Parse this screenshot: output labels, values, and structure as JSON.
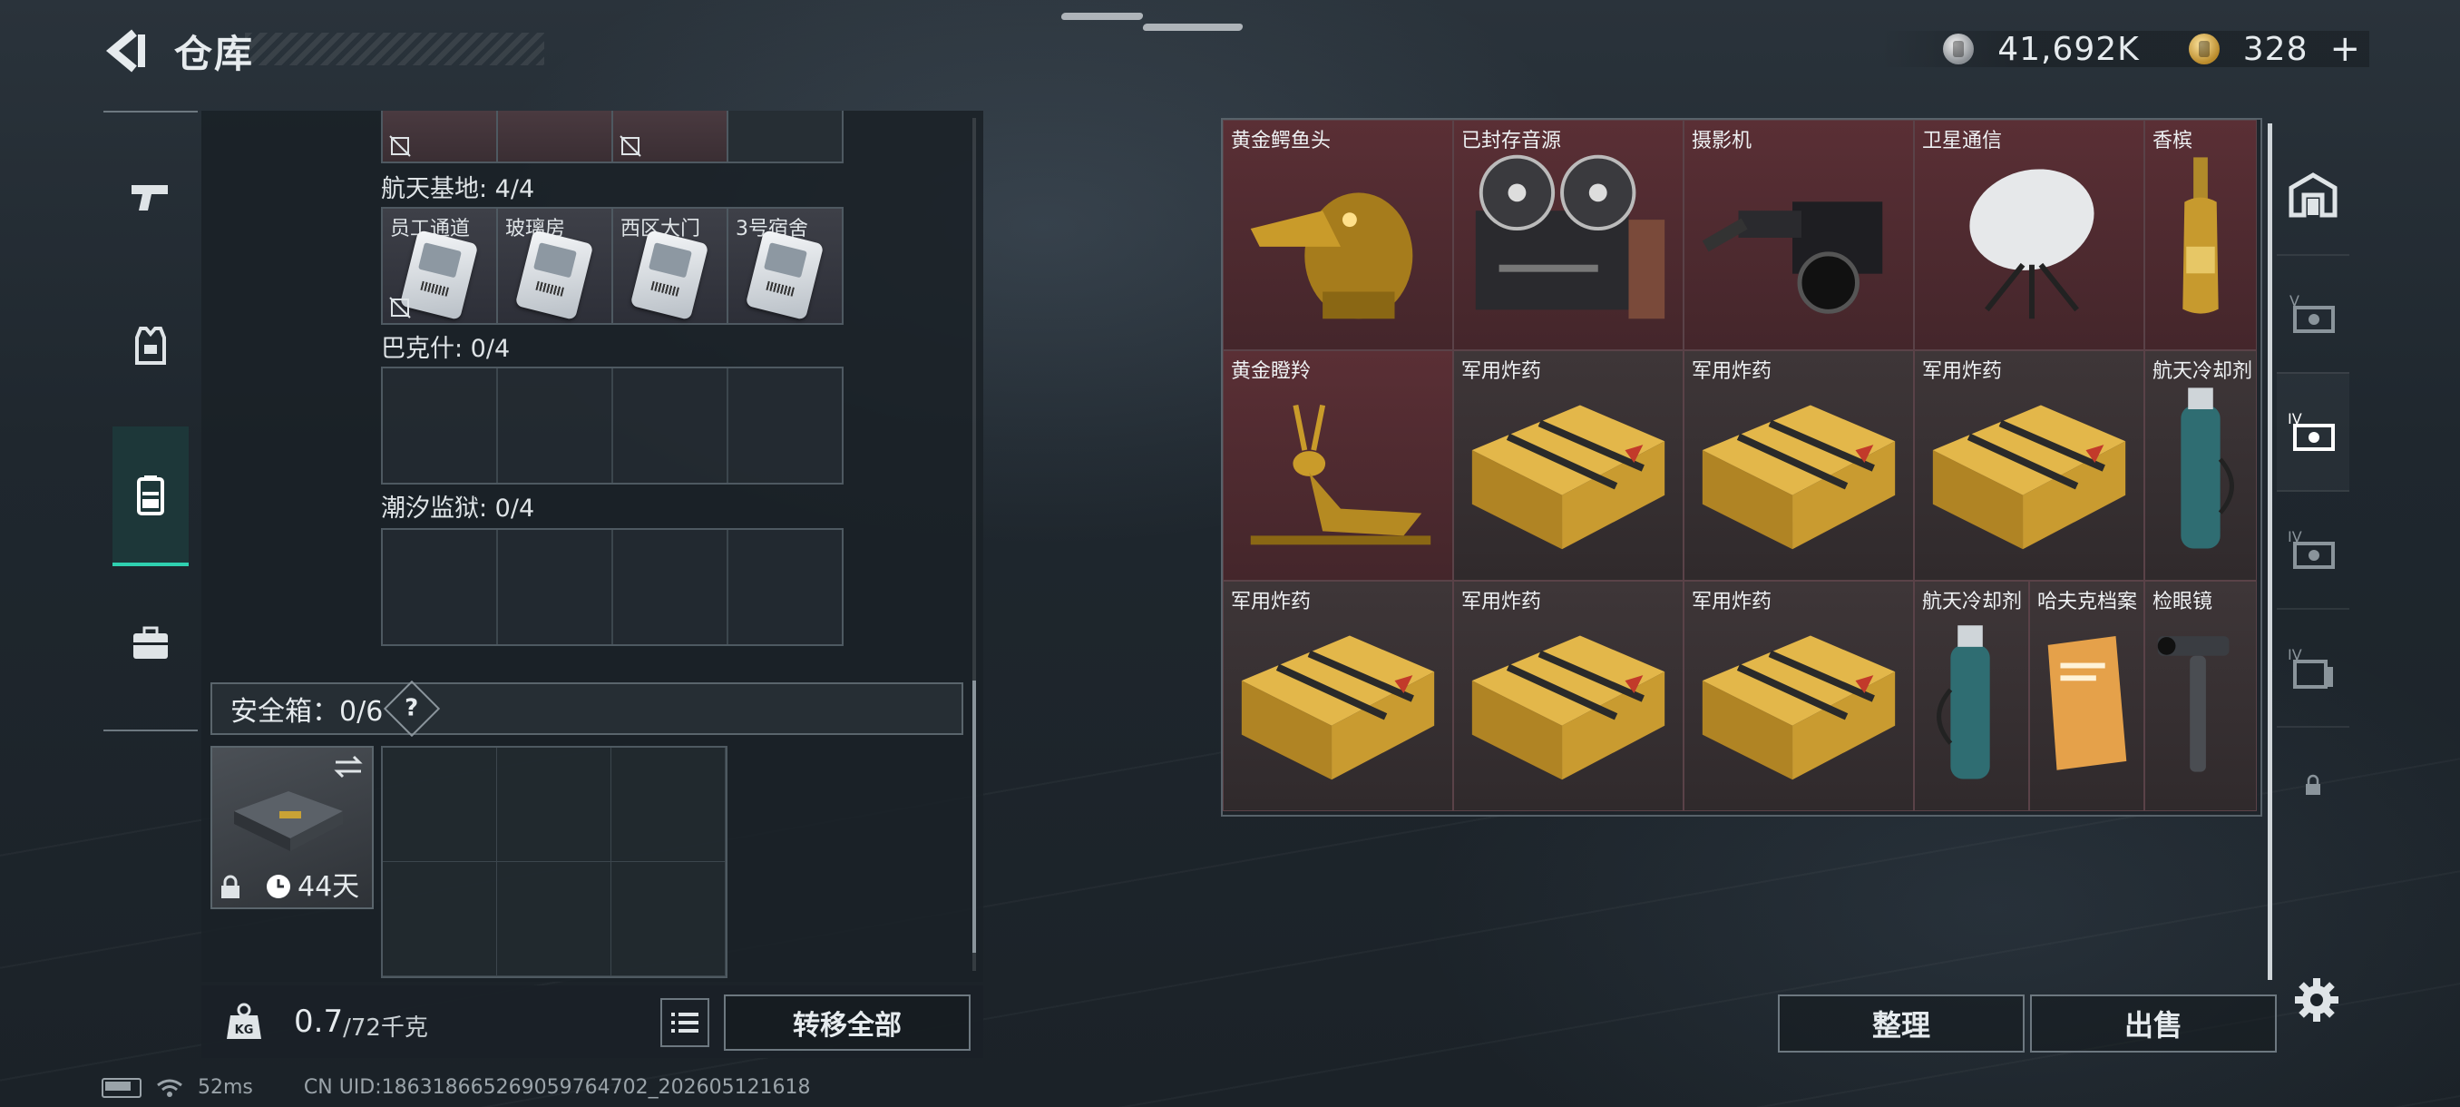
{
  "header": {
    "title": "仓库",
    "silver_amount": "41,692K",
    "gold_amount": "328",
    "gold_add": "+"
  },
  "left_nav": [
    {
      "icon": "pistol-icon"
    },
    {
      "icon": "armor-vest-icon"
    },
    {
      "icon": "backpack-icon",
      "active": true
    },
    {
      "icon": "briefcase-icon"
    }
  ],
  "key_groups": [
    {
      "label": "航天基地: 4/4",
      "keys": [
        "员工通道",
        "玻璃房",
        "西区大门",
        "3号宿舍"
      ]
    },
    {
      "label": "巴克什: 0/4"
    },
    {
      "label": "潮汐监狱: 0/4"
    }
  ],
  "safe_box": {
    "label": "安全箱：0/6",
    "help": "?",
    "days": "44天"
  },
  "weight": {
    "current": "0.7",
    "max": "/72千克"
  },
  "buttons": {
    "transfer_all": "转移全部",
    "sort": "整理",
    "sell": "出售"
  },
  "status": {
    "ping": "52ms",
    "uid": "CN UID:186318665269059764702_202605121618"
  },
  "stash_items": [
    {
      "name": "黄金鳄鱼头",
      "style": "red",
      "icon": "gold-crocodile-head-icon"
    },
    {
      "name": "已封存音源",
      "style": "red",
      "icon": "reel-to-reel-recorder-icon"
    },
    {
      "name": "摄影机",
      "style": "red",
      "icon": "film-camera-icon"
    },
    {
      "name": "卫星通信",
      "style": "red",
      "icon": "satellite-dish-icon"
    },
    {
      "name": "香槟",
      "style": "red",
      "icon": "champagne-bottle-icon"
    },
    {
      "name": "黄金瞪羚",
      "style": "red",
      "icon": "gold-gazelle-icon"
    },
    {
      "name": "军用炸药",
      "style": "dark",
      "icon": "explosive-crate-icon"
    },
    {
      "name": "军用炸药",
      "style": "dark",
      "icon": "explosive-crate-icon"
    },
    {
      "name": "军用炸药",
      "style": "dark",
      "icon": "explosive-crate-icon"
    },
    {
      "name": "航天冷却剂",
      "style": "dark",
      "icon": "coolant-tank-icon"
    },
    {
      "name": "军用炸药",
      "style": "dark",
      "icon": "explosive-crate-icon"
    },
    {
      "name": "军用炸药",
      "style": "dark",
      "icon": "explosive-crate-icon"
    },
    {
      "name": "军用炸药",
      "style": "dark",
      "icon": "explosive-crate-icon"
    },
    {
      "name": "航天冷却剂",
      "style": "dark",
      "icon": "coolant-tank-icon"
    },
    {
      "name": "哈夫克档案",
      "style": "dark",
      "icon": "document-file-icon"
    },
    {
      "name": "检眼镜",
      "style": "dark",
      "icon": "ophthalmoscope-icon"
    }
  ],
  "category_tabs": [
    {
      "icon": "all-items-icon"
    },
    {
      "icon": "stash-v-icon"
    },
    {
      "icon": "stash-iv-active-icon",
      "active": true
    },
    {
      "icon": "stash-iv-icon"
    },
    {
      "icon": "stash-iv-alt-icon"
    },
    {
      "icon": "locked-tab-icon"
    }
  ],
  "colors": {
    "accent": "#2fd0b0",
    "red_item_bg": "#5a2f35",
    "panel_bg": "#1a2127"
  }
}
